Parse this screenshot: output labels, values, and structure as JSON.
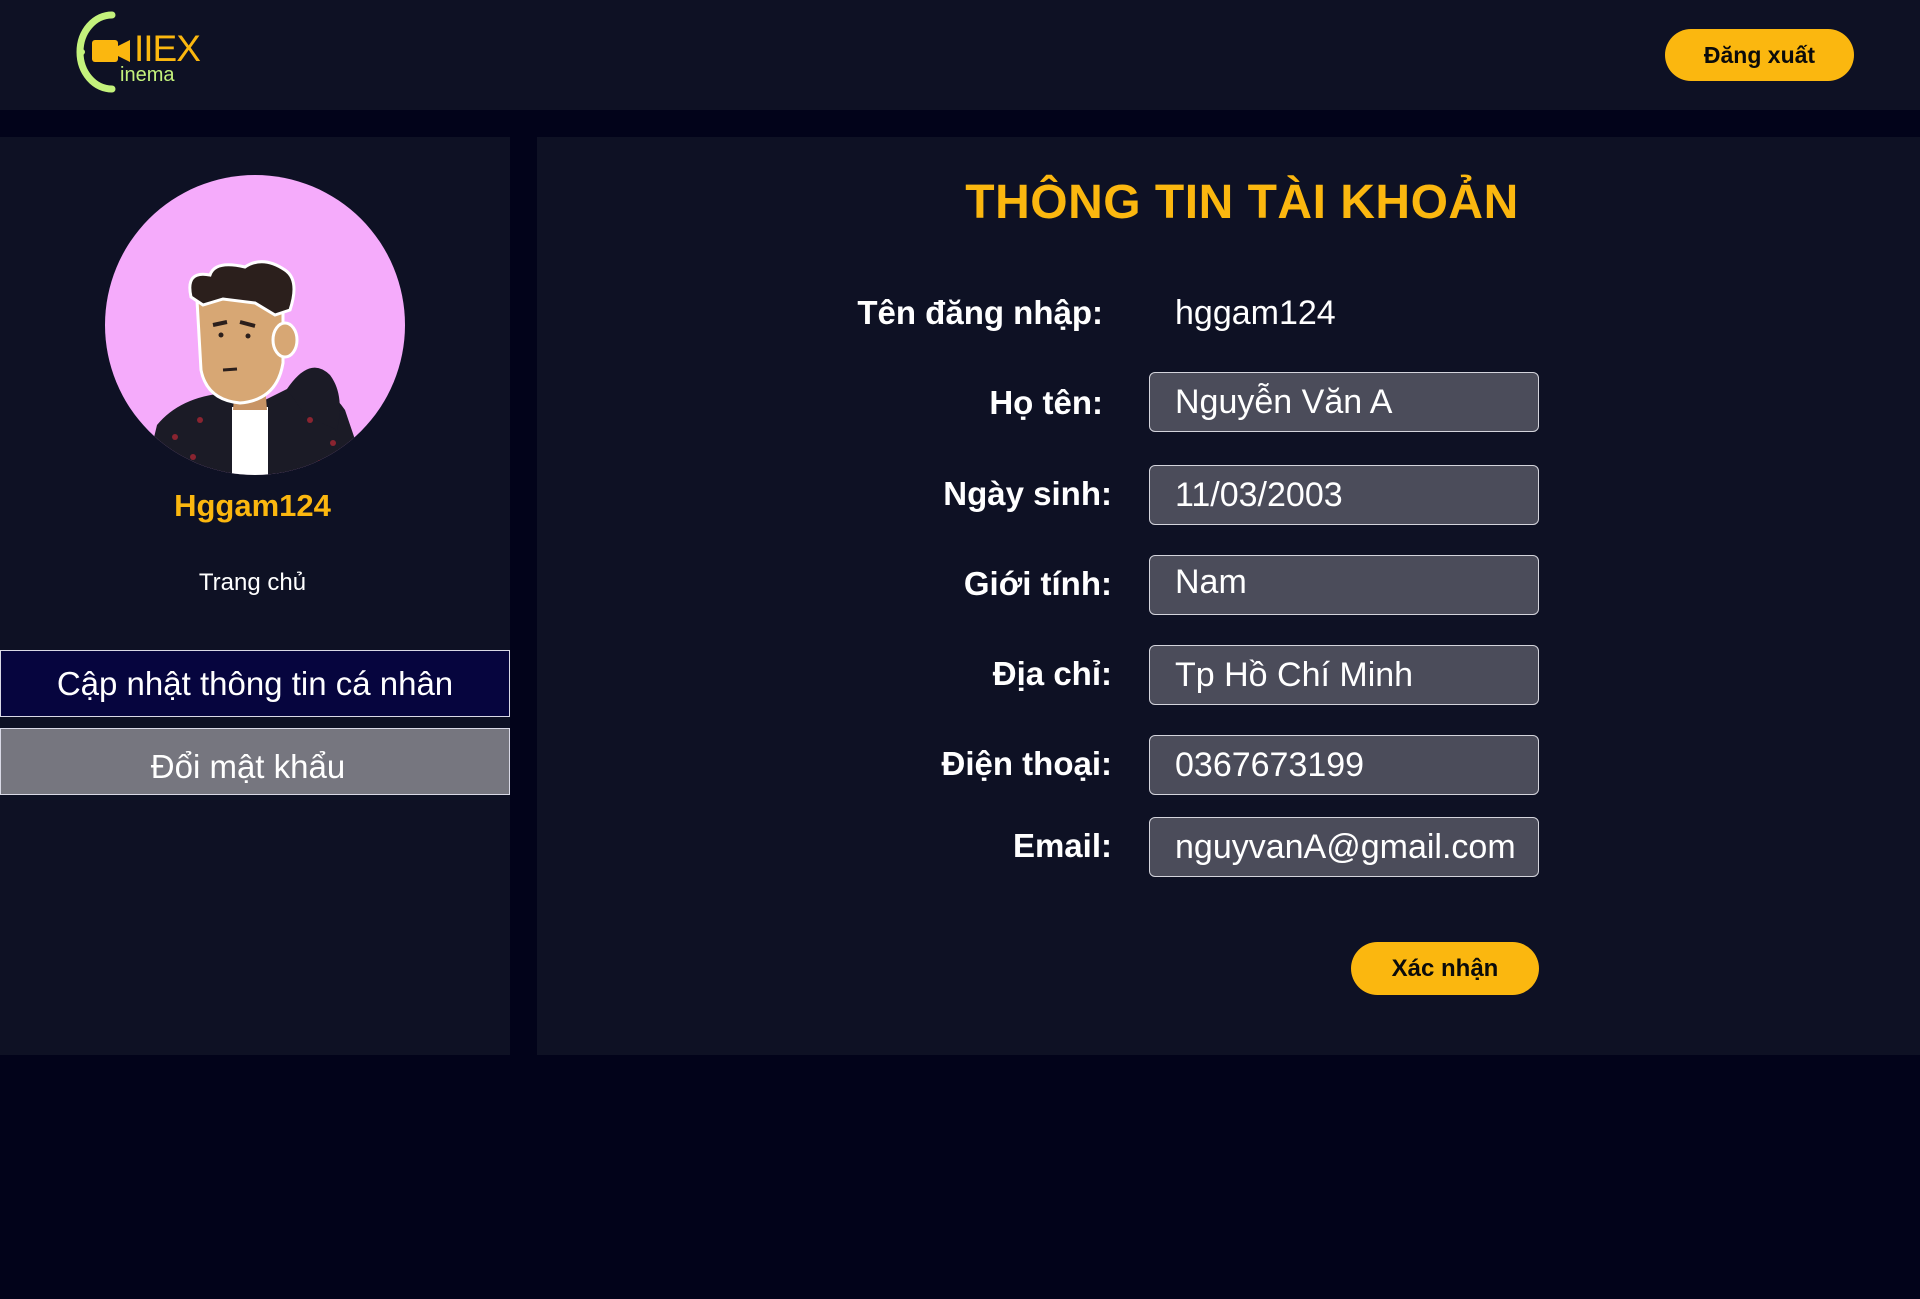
{
  "header": {
    "logo_text": "IIEX",
    "logo_subtext": "inema",
    "logout_label": "Đăng xuất"
  },
  "sidebar": {
    "username": "Hggam124",
    "home_label": "Trang chủ",
    "update_label": "Cập nhật thông tin cá nhân",
    "password_label": "Đổi mật khẩu"
  },
  "form": {
    "title": "THÔNG TIN TÀI KHOẢN",
    "username_label": "Tên đăng nhập:",
    "username_value": "hggam124",
    "fullname_label": "Họ tên:",
    "fullname_value": "Nguyễn Văn A",
    "birthday_label": "Ngày sinh:",
    "birthday_value": "11/03/2003",
    "gender_label": "Giới tính:",
    "gender_value": "Nam",
    "address_label": "Địa chỉ:",
    "address_value": "Tp Hồ Chí Minh",
    "phone_label": "Điện thoại:",
    "phone_value": "0367673199",
    "email_label": "Email:",
    "email_value": "nguyvanA@gmail.com",
    "confirm_label": "Xác nhận"
  },
  "colors": {
    "accent": "#fbb70f",
    "logo_green": "#c4f27c",
    "panel": "#0e1124",
    "background": "#02031a",
    "input": "#4b4c5a",
    "avatar_bg": "#f5abfb"
  },
  "icons": [
    "camera-icon",
    "user-avatar"
  ]
}
